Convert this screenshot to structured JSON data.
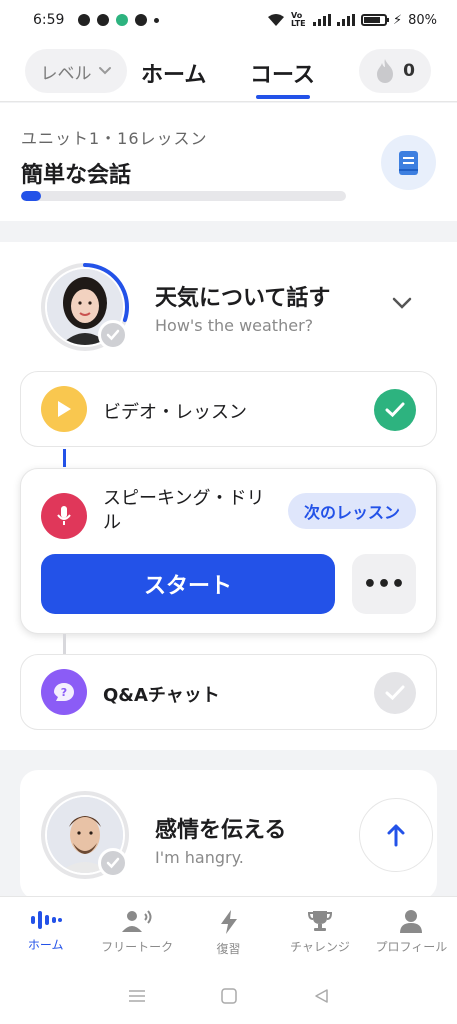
{
  "status_bar": {
    "time": "6:59",
    "battery": "80%",
    "battery_level": 0.8,
    "network_label": "VoLTE"
  },
  "header": {
    "level_label": "レベル",
    "tabs": [
      {
        "label": "ホーム",
        "active": false
      },
      {
        "label": "コース",
        "active": true
      }
    ],
    "streak_count": "0"
  },
  "unit": {
    "subtitle": "ユニット1・16レッスン",
    "title": "簡単な会話",
    "progress": 0.06
  },
  "lesson_group": {
    "title": "天気について話す",
    "subtitle": "How's the weather?",
    "progress_ring": 0.3,
    "lessons": [
      {
        "label": "ビデオ・レッスン",
        "status": "completed"
      },
      {
        "label": "スピーキング・ドリル",
        "status": "next",
        "badge": "次のレッスン",
        "start_label": "スタート",
        "more_label": "•••"
      },
      {
        "label": "Q&Aチャット",
        "status": "locked"
      }
    ]
  },
  "next_group": {
    "title": "感情を伝える",
    "subtitle": "I'm hangry."
  },
  "bottom_nav": {
    "items": [
      {
        "label": "ホーム",
        "icon": "home-waveform-icon",
        "active": true
      },
      {
        "label": "フリートーク",
        "icon": "free-talk-icon",
        "active": false
      },
      {
        "label": "復習",
        "icon": "lightning-icon",
        "active": false
      },
      {
        "label": "チャレンジ",
        "icon": "trophy-icon",
        "active": false
      },
      {
        "label": "プロフィール",
        "icon": "profile-icon",
        "active": false
      }
    ]
  },
  "colors": {
    "accent": "#2352e8",
    "success": "#2db37f",
    "video": "#f9c74f",
    "speaking": "#e0375a",
    "chat": "#8b5cf6"
  }
}
